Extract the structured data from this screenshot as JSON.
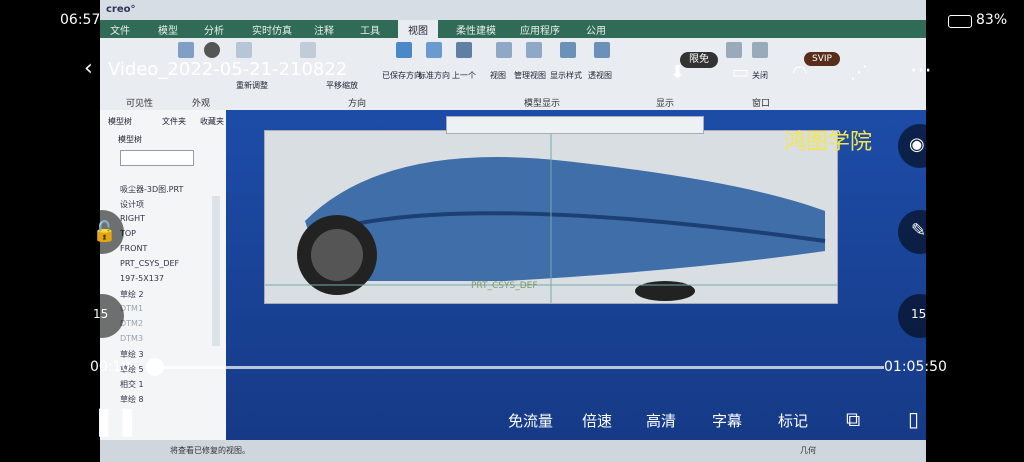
{
  "status_bar": {
    "time": "06:57",
    "battery": "83%"
  },
  "player": {
    "title": "Video_2022-05-21-210822",
    "badge_limited": "限免",
    "badge_svip": "SVIP",
    "elapsed": "00:10",
    "duration": "01:05:50",
    "progress": 0.0025,
    "skip_back": "15",
    "skip_fwd": "15",
    "controls": [
      "免流量",
      "倍速",
      "高清",
      "字幕",
      "标记"
    ],
    "watermark": "鸿图学院"
  },
  "app": {
    "tabs": [
      "文件",
      "模型",
      "分析",
      "实时仿真",
      "注释",
      "工具",
      "视图",
      "柔性建模",
      "应用程序",
      "公用"
    ],
    "active_tab": "视图",
    "groups": [
      "可见性",
      "外观",
      "方向",
      "模型显示",
      "显示",
      "窗口"
    ],
    "buttons": [
      "已保存方向",
      "标准方向",
      "上一个",
      "视图",
      "管理视图",
      "显示样式",
      "透视图",
      "重新调整",
      "平移缩放",
      "关闭"
    ],
    "tree_tabs": [
      "模型树",
      "文件夹",
      "收藏夹"
    ],
    "tree_header": "模型树",
    "tree_items": [
      {
        "label": "吸尘器-3D图.PRT",
        "dim": false
      },
      {
        "label": "设计项",
        "dim": false
      },
      {
        "label": "RIGHT",
        "dim": false
      },
      {
        "label": "TOP",
        "dim": false
      },
      {
        "label": "FRONT",
        "dim": false
      },
      {
        "label": "PRT_CSYS_DEF",
        "dim": false
      },
      {
        "label": "197-5X137",
        "dim": false
      },
      {
        "label": "草绘 2",
        "dim": false
      },
      {
        "label": "DTM1",
        "dim": true
      },
      {
        "label": "DTM2",
        "dim": true
      },
      {
        "label": "DTM3",
        "dim": true
      },
      {
        "label": "草绘 3",
        "dim": false
      },
      {
        "label": "草绘 5",
        "dim": false
      },
      {
        "label": "相交 1",
        "dim": false
      },
      {
        "label": "草绘 8",
        "dim": false
      }
    ],
    "csys_label": "PRT_CSYS_DEF",
    "status_text": "将查看已修复的视图。",
    "status_right": "几何"
  }
}
